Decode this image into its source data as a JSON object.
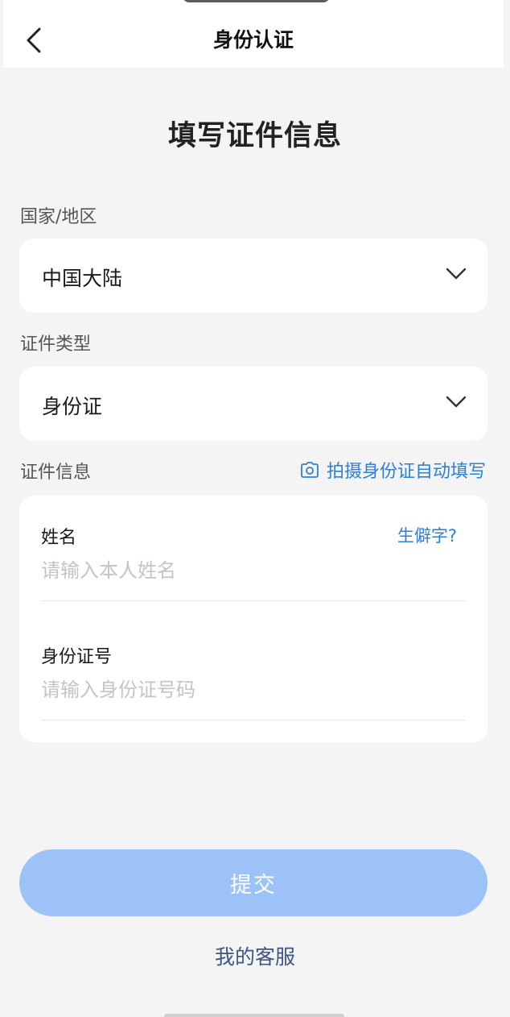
{
  "header": {
    "title": "身份认证",
    "back_icon": "chevron-left-icon"
  },
  "main": {
    "title": "填写证件信息"
  },
  "region": {
    "label": "国家/地区",
    "value": "中国大陆"
  },
  "id_type": {
    "label": "证件类型",
    "value": "身份证"
  },
  "id_info": {
    "label": "证件信息",
    "autofill_label": "拍摄身份证自动填写",
    "name_field": {
      "label": "姓名",
      "placeholder": "请输入本人姓名",
      "value": "",
      "rare_char_link": "生僻字?"
    },
    "id_number_field": {
      "label": "身份证号",
      "placeholder": "请输入身份证号码",
      "value": ""
    }
  },
  "actions": {
    "submit_label": "提交",
    "service_label": "我的客服"
  },
  "colors": {
    "accent": "#2f7fd6",
    "submit_disabled": "#9cc2f7",
    "service_link": "#3b5683",
    "background": "#f4f4f4"
  }
}
